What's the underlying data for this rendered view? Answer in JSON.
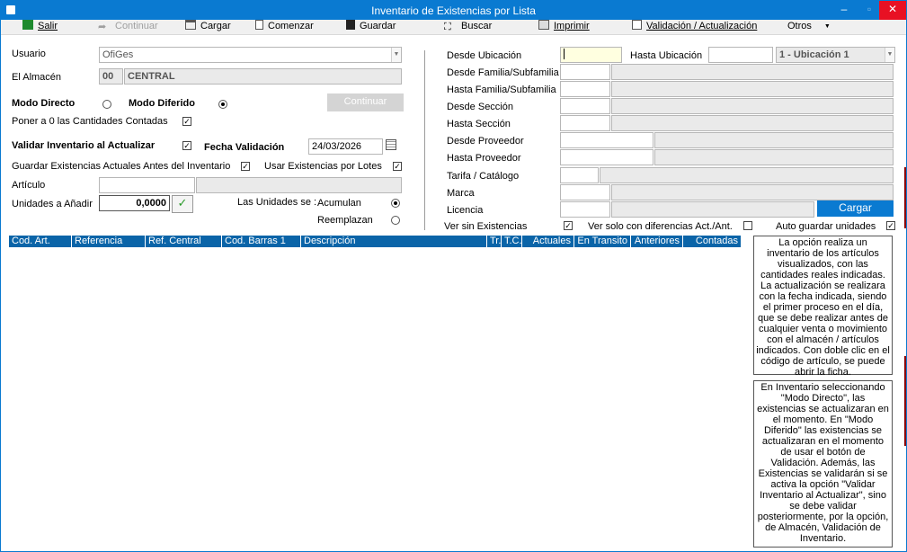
{
  "window": {
    "title": "Inventario de Existencias por Lista"
  },
  "toolbar": {
    "salir": "Salir",
    "continuar": "Continuar",
    "cargar": "Cargar",
    "comenzar": "Comenzar",
    "guardar": "Guardar",
    "buscar": "Buscar",
    "imprimir": "Imprimir",
    "validacion": "Validación / Actualización",
    "otros": "Otros"
  },
  "left": {
    "usuario_label": "Usuario",
    "usuario_value": "OfiGes",
    "almacen_label": "El Almacén",
    "almacen_code": "00",
    "almacen_name": "CENTRAL",
    "modo_directo": "Modo Directo",
    "modo_diferido": "Modo Diferido",
    "continuar_btn": "Continuar",
    "poner_cero": "Poner a 0 las Cantidades Contadas",
    "validar_inventario": "Validar Inventario al Actualizar",
    "fecha_validacion_label": "Fecha Validación",
    "fecha_validacion_value": "24/03/2026",
    "guardar_existencias": "Guardar Existencias Actuales Antes del Inventario",
    "usar_existencias_lotes": "Usar Existencias por Lotes",
    "articulo_label": "Artículo",
    "unidades_label": "Unidades a Añadir",
    "unidades_value": "0,0000",
    "las_unidades_se": "Las Unidades se :",
    "acumulan": "Acumulan",
    "reemplazan": "Reemplazan"
  },
  "right": {
    "desde_ubicacion": "Desde Ubicación",
    "hasta_ubicacion": "Hasta Ubicación",
    "hasta_ubicacion_value": "1 - Ubicación 1",
    "desde_familia": "Desde Familia/Subfamilia",
    "hasta_familia": "Hasta Familia/Subfamilia",
    "desde_seccion": "Desde Sección",
    "hasta_seccion": "Hasta Sección",
    "desde_proveedor": "Desde Proveedor",
    "hasta_proveedor": "Hasta Proveedor",
    "tarifa": "Tarifa / Catálogo",
    "marca": "Marca",
    "licencia": "Licencia",
    "cargar_btn": "Cargar",
    "ver_sin_existencias": "Ver sin Existencias",
    "ver_solo_diferencias": "Ver solo con diferencias Act./Ant.",
    "auto_guardar": "Auto guardar unidades"
  },
  "grid": {
    "columns": [
      "Cod. Art.",
      "Referencia",
      "Ref. Central",
      "Cod. Barras 1",
      "Descripción",
      "Tr.",
      "T.C.",
      "Actuales",
      "En Transito",
      "Anteriores",
      "Contadas"
    ]
  },
  "info": {
    "box1": "La opción realiza un inventario de los artículos visualizados, con las cantidades reales indicadas. La actualización se realizara con la fecha indicada, siendo el primer proceso en el día, que se debe realizar antes de cualquier venta o movimiento con el almacén / artículos indicados. Con doble clic en el código de artículo, se puede abrir la ficha.",
    "box2": "En Inventario seleccionando \"Modo Directo\", las existencias se actualizaran en el momento. En \"Modo Diferido\" las existencias se actualizaran en el momento de usar el botón de Validación. Además, las Existencias se validarán si se activa la opción \"Validar Inventario al Actualizar\", sino se debe validar posteriormente, por la opción, de Almacén, Validación de Inventario."
  },
  "colors": {
    "accent": "#0a7ad1",
    "grid_header": "#0a64a8",
    "close": "#e81123"
  }
}
